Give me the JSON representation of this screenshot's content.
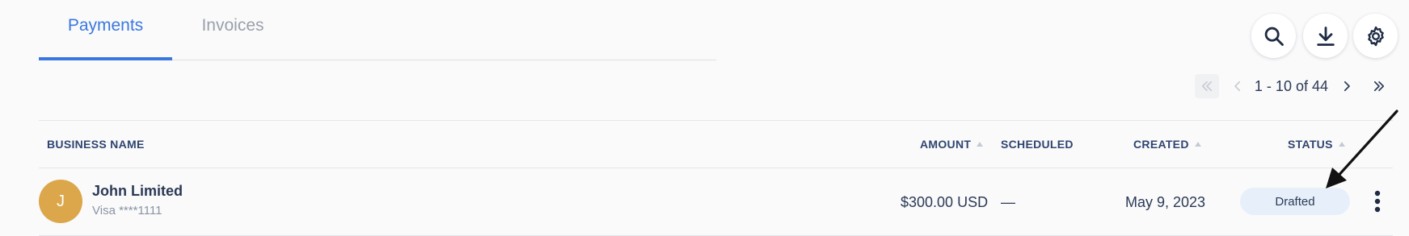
{
  "tabs": [
    {
      "label": "Payments",
      "active": true
    },
    {
      "label": "Invoices",
      "active": false
    }
  ],
  "toolbar": {
    "search_icon": "search-icon",
    "download_icon": "download-icon",
    "settings_icon": "gear-icon"
  },
  "pagination": {
    "range_text": "1 - 10 of 44"
  },
  "table": {
    "columns": {
      "business": "BUSINESS NAME",
      "amount": "AMOUNT",
      "scheduled": "SCHEDULED",
      "created": "CREATED",
      "status": "STATUS"
    },
    "rows": [
      {
        "avatar_initial": "J",
        "business_name": "John Limited",
        "card": "Visa ****1111",
        "amount": "$300.00 USD",
        "scheduled": "—",
        "created": "May 9, 2023",
        "status": "Drafted"
      }
    ]
  },
  "colors": {
    "accent": "#3a78e0",
    "avatar": "#dca64a",
    "status_badge_bg": "#e7f0fa"
  }
}
